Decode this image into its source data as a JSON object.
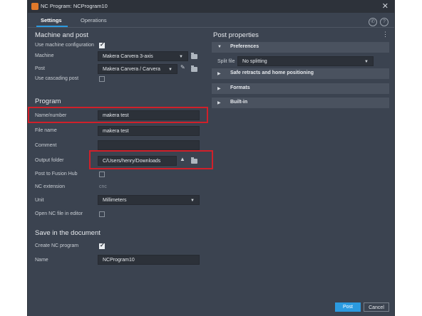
{
  "window": {
    "title": "NC Program: NCProgram10"
  },
  "tabs": [
    {
      "label": "Settings"
    },
    {
      "label": "Operations"
    }
  ],
  "machine_post": {
    "title": "Machine and post",
    "use_machine_configuration": {
      "label": "Use machine configuration",
      "checked": true
    },
    "machine": {
      "label": "Machine",
      "value": "Makera Carvera 3-axis"
    },
    "post": {
      "label": "Post",
      "value": "Makera Carvera / Carvera"
    },
    "use_cascading_post": {
      "label": "Use cascading post",
      "checked": false
    }
  },
  "program": {
    "title": "Program",
    "name_number": {
      "label": "Name/number",
      "value": "makera test"
    },
    "file_name": {
      "label": "File name",
      "value": "makera test"
    },
    "comment": {
      "label": "Comment",
      "value": ""
    },
    "output_folder": {
      "label": "Output folder",
      "value": "C/Users/henry/Downloads"
    },
    "post_to_fusion_hub": {
      "label": "Post to Fusion Hub",
      "checked": false
    },
    "nc_extension": {
      "label": "NC extension",
      "value": "cnc"
    },
    "unit": {
      "label": "Unit",
      "value": "Millimeters"
    },
    "open_nc_file": {
      "label": "Open NC file in editor",
      "checked": false
    }
  },
  "save_doc": {
    "title": "Save in the document",
    "create_nc_program": {
      "label": "Create NC program",
      "checked": true
    },
    "name": {
      "label": "Name",
      "value": "NCProgram10"
    }
  },
  "post_properties": {
    "title": "Post properties",
    "preferences": {
      "label": "Preferences"
    },
    "split_file": {
      "label": "Split file",
      "value": "No splitting"
    },
    "sections": [
      {
        "label": "Safe retracts and home positioning"
      },
      {
        "label": "Formats"
      },
      {
        "label": "Built-in"
      }
    ]
  },
  "footer": {
    "post_label": "Post",
    "cancel_label": "Cancel"
  },
  "colors": {
    "accent": "#2b9ae0",
    "highlight": "#d0202a",
    "window_bg": "#3b4350"
  }
}
